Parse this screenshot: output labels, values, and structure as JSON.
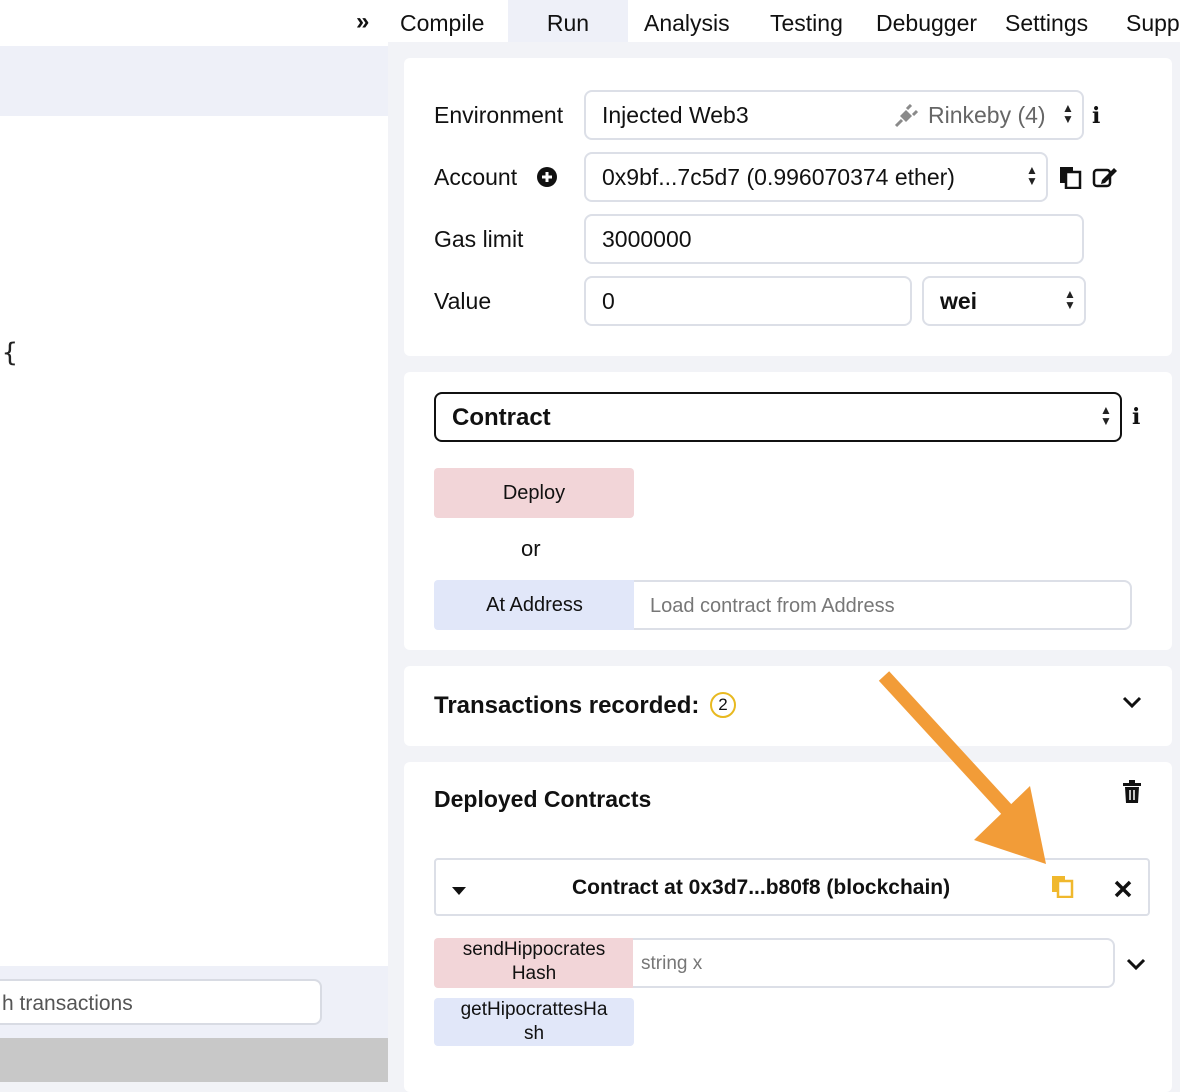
{
  "tabs": {
    "collapse_icon": "double-chevron-right",
    "items": [
      {
        "label": "Compile"
      },
      {
        "label": "Run"
      },
      {
        "label": "Analysis"
      },
      {
        "label": "Testing"
      },
      {
        "label": "Debugger"
      },
      {
        "label": "Settings"
      },
      {
        "label": "Supp"
      }
    ],
    "active": "Run"
  },
  "editor": {
    "brace": "{",
    "search_placeholder": "h transactions"
  },
  "environment": {
    "label": "Environment",
    "value": "Injected Web3",
    "network": "Rinkeby (4)",
    "network_icon": "plug-icon",
    "info_icon": "info-icon"
  },
  "account": {
    "label": "Account",
    "add_icon": "plus-circle-icon",
    "value": "0x9bf...7c5d7 (0.996070374 ether)",
    "copy_icon": "copy-icon",
    "edit_icon": "edit-icon"
  },
  "gas_limit": {
    "label": "Gas limit",
    "value": "3000000"
  },
  "value": {
    "label": "Value",
    "amount": "0",
    "unit": "wei"
  },
  "contract": {
    "selected": "Contract",
    "deploy_label": "Deploy",
    "or_label": "or",
    "at_address_label": "At Address",
    "at_address_placeholder": "Load contract from Address"
  },
  "transactions": {
    "label": "Transactions recorded:",
    "count": "2"
  },
  "deployed": {
    "title": "Deployed Contracts",
    "instance_title": "Contract at 0x3d7...b80f8 (blockchain)",
    "functions": [
      {
        "line1": "sendHippocrates",
        "line2": "Hash",
        "input_placeholder": "string x"
      },
      {
        "line1": "getHipocrattesHa",
        "line2": "sh"
      }
    ]
  },
  "colors": {
    "annotation_arrow": "#f29c38",
    "transact_button": "#f2d5d8",
    "call_button": "#e1e7f9",
    "badge_border": "#e8b920",
    "copy_icon_highlight": "#f0b82d"
  }
}
